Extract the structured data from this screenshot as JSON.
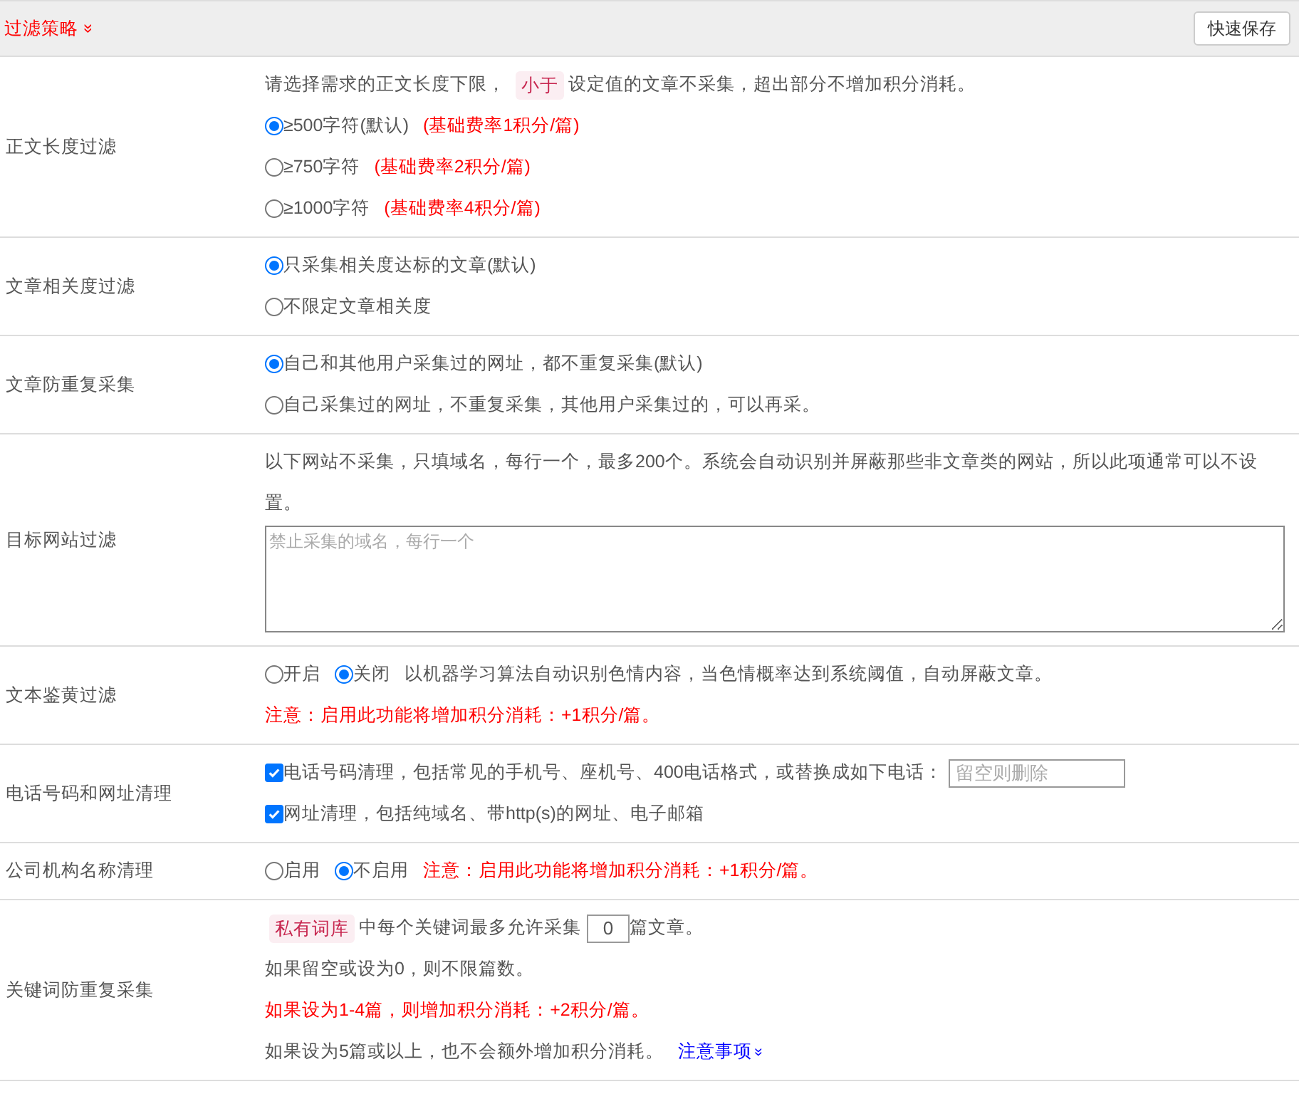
{
  "header": {
    "title": "过滤策略",
    "toggle": "»",
    "save_button": "快速保存"
  },
  "rows": [
    {
      "label": "正文长度过滤",
      "lines": [
        [
          {
            "kind": "text",
            "text": "请选择需求的正文长度下限，"
          },
          {
            "kind": "tag",
            "text": "小于"
          },
          {
            "kind": "text",
            "text": "设定值的文章不采集，超出部分不增加积分消耗。"
          }
        ],
        [
          {
            "kind": "radio",
            "text": "≥500字符(默认)",
            "selected": true
          },
          {
            "kind": "note",
            "text": "(基础费率1积分/篇)"
          }
        ],
        [
          {
            "kind": "radio",
            "text": "≥750字符",
            "selected": false
          },
          {
            "kind": "note",
            "text": "(基础费率2积分/篇)"
          }
        ],
        [
          {
            "kind": "radio",
            "text": "≥1000字符",
            "selected": false
          },
          {
            "kind": "note",
            "text": "(基础费率4积分/篇)"
          }
        ]
      ]
    },
    {
      "label": "文章相关度过滤",
      "lines": [
        [
          {
            "kind": "radio",
            "text": "只采集相关度达标的文章(默认)",
            "selected": true
          }
        ],
        [
          {
            "kind": "radio",
            "text": "不限定文章相关度",
            "selected": false
          }
        ]
      ]
    },
    {
      "label": "文章防重复采集",
      "lines": [
        [
          {
            "kind": "radio",
            "text": "自己和其他用户采集过的网址，都不重复采集(默认)",
            "selected": true
          }
        ],
        [
          {
            "kind": "radio",
            "text": "自己采集过的网址，不重复采集，其他用户采集过的，可以再采。",
            "selected": false
          }
        ]
      ]
    },
    {
      "label": "目标网站过滤",
      "lines": [
        [
          {
            "kind": "text",
            "text": "以下网站不采集，只填域名，每行一个，最多200个。系统会自动识别并屏蔽那些非文章类的网站，所以此项通常可以不设置。"
          }
        ],
        [
          {
            "kind": "textarea",
            "placeholder": "禁止采集的域名，每行一个"
          }
        ]
      ]
    },
    {
      "label": "文本鉴黄过滤",
      "lines": [
        [
          {
            "kind": "radio",
            "text": "开启",
            "selected": false
          },
          {
            "kind": "radio",
            "text": "关闭",
            "selected": true
          },
          {
            "kind": "text",
            "text": "以机器学习算法自动识别色情内容，当色情概率达到系统阈值，自动屏蔽文章。"
          }
        ],
        [
          {
            "kind": "note",
            "text": "注意：启用此功能将增加积分消耗：+1积分/篇。"
          }
        ]
      ]
    },
    {
      "label": "电话号码和网址清理",
      "lines": [
        [
          {
            "kind": "checkbox",
            "text": "电话号码清理，包括常见的手机号、座机号、400电话格式，或替换成如下电话：",
            "checked": true
          },
          {
            "kind": "input",
            "placeholder": "留空则删除"
          }
        ],
        [
          {
            "kind": "checkbox",
            "text": "网址清理，包括纯域名、带http(s)的网址、电子邮箱",
            "checked": true
          }
        ]
      ]
    },
    {
      "label": "公司机构名称清理",
      "lines": [
        [
          {
            "kind": "radio",
            "text": "启用",
            "selected": false
          },
          {
            "kind": "radio",
            "text": "不启用",
            "selected": true
          },
          {
            "kind": "note",
            "text": "注意：启用此功能将增加积分消耗：+1积分/篇。"
          }
        ]
      ]
    },
    {
      "label": "关键词防重复采集",
      "lines": [
        [
          {
            "kind": "tag",
            "text": "私有词库"
          },
          {
            "kind": "text",
            "text": "中每个关键词最多允许采集"
          },
          {
            "kind": "number",
            "value": "0"
          },
          {
            "kind": "text",
            "text": "篇文章。"
          }
        ],
        [
          {
            "kind": "text",
            "text": "如果留空或设为0，则不限篇数。"
          }
        ],
        [
          {
            "kind": "note",
            "text": "如果设为1-4篇，则增加积分消耗：+2积分/篇。"
          }
        ],
        [
          {
            "kind": "text",
            "text": "如果设为5篇或以上，也不会额外增加积分消耗。"
          },
          {
            "kind": "link",
            "text": "注意事项",
            "toggle": "»"
          }
        ]
      ]
    }
  ]
}
